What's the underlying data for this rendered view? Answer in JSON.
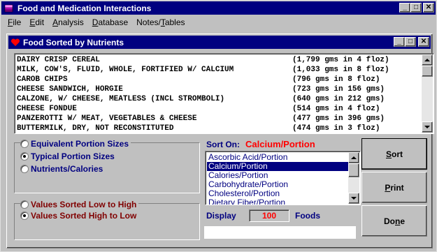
{
  "app": {
    "title": "Food and Medication Interactions",
    "menu": [
      {
        "u": "F",
        "rest": "ile"
      },
      {
        "u": "E",
        "rest": "dit"
      },
      {
        "u": "A",
        "rest": "nalysis"
      },
      {
        "u": "D",
        "rest": "atabase"
      },
      {
        "u": "",
        "rest": "Notes/",
        "u2": "T",
        "rest2": "ables"
      }
    ],
    "window_buttons": {
      "minimize": "_",
      "maximize": "□",
      "close": "✕"
    }
  },
  "child": {
    "title": "Food Sorted by Nutrients",
    "foods": [
      {
        "name": "DAIRY CRISP CEREAL",
        "portion": "(1,799 gms in 4 floz)"
      },
      {
        "name": "MILK, COW'S, FLUID, WHOLE, FORTIFIED W/ CALCIUM",
        "portion": "(1,033 gms in 8 floz)"
      },
      {
        "name": "CAROB CHIPS",
        "portion": "(796 gms in 8 floz)"
      },
      {
        "name": "CHEESE SANDWICH, HORGIE",
        "portion": "(723 gms in 156 gms)"
      },
      {
        "name": "CALZONE, W/ CHEESE, MEATLESS (INCL STROMBOLI)",
        "portion": "(640 gms in 212 gms)"
      },
      {
        "name": "CHEESE FONDUE",
        "portion": "(514 gms in 4 floz)"
      },
      {
        "name": "PANZEROTTI W/ MEAT, VEGETABLES & CHEESE",
        "portion": "(477 gms in 396 gms)"
      },
      {
        "name": "BUTTERMILK, DRY, NOT RECONSTITUTED",
        "portion": "(474 gms in 3 floz)"
      }
    ],
    "portion_options": [
      {
        "label": "Equivalent Portion Sizes",
        "selected": false
      },
      {
        "label": "Typical Portion Sizes",
        "selected": true
      },
      {
        "label": "Nutrients/Calories",
        "selected": false
      }
    ],
    "sort_options": [
      {
        "label": "Values Sorted Low to High",
        "selected": false
      },
      {
        "label": "Values Sorted High to Low",
        "selected": true
      }
    ],
    "sort_on_label": "Sort On:",
    "sort_on_value": "Calcium/Portion",
    "nutrients": [
      {
        "label": "Ascorbic Acid/Portion",
        "selected": false
      },
      {
        "label": "Calcium/Portion",
        "selected": true
      },
      {
        "label": "Calories/Portion",
        "selected": false
      },
      {
        "label": "Carbohydrate/Portion",
        "selected": false
      },
      {
        "label": "Cholesterol/Portion",
        "selected": false
      },
      {
        "label": "Dietary Fiber/Portion",
        "selected": false
      }
    ],
    "display_label": "Display",
    "display_count": "100",
    "foods_label": "Foods",
    "buttons": {
      "sort": {
        "u": "S",
        "rest": "ort"
      },
      "print": {
        "u": "P",
        "rest": "rint"
      },
      "done": {
        "pre": "Do",
        "u": "n",
        "rest": "e"
      }
    }
  },
  "colors": {
    "titlebar": "#000080",
    "accent_red": "#ff0000",
    "label_blue": "#000080",
    "label_maroon": "#800000",
    "heart": "#ff0000"
  }
}
